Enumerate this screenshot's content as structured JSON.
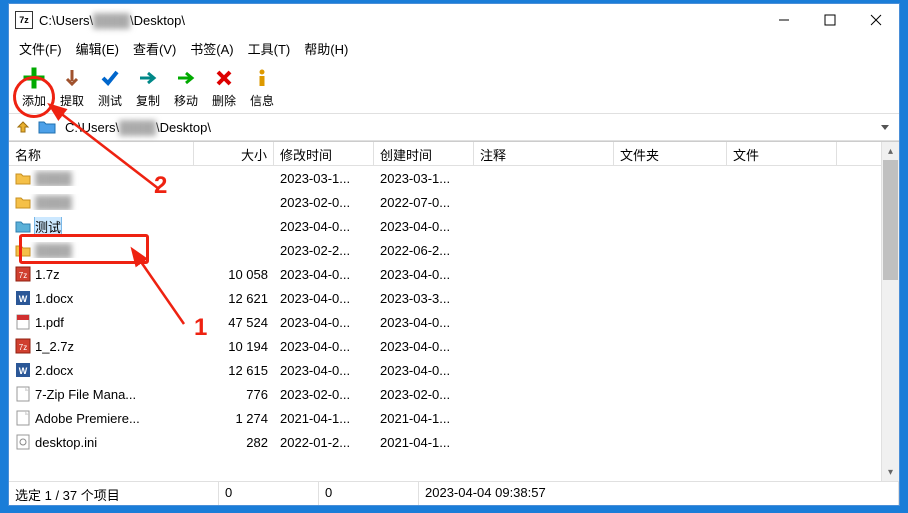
{
  "window": {
    "title_prefix": "C:\\Users\\",
    "title_suffix": "\\Desktop\\"
  },
  "menu": {
    "file": "文件(F)",
    "edit": "编辑(E)",
    "view": "查看(V)",
    "bookmark": "书签(A)",
    "tools": "工具(T)",
    "help": "帮助(H)"
  },
  "toolbar": {
    "add": "添加",
    "extract": "提取",
    "test": "测试",
    "copy": "复制",
    "move": "移动",
    "delete": "删除",
    "info": "信息"
  },
  "address": {
    "prefix": "C:\\Users\\",
    "suffix": "\\Desktop\\"
  },
  "columns": {
    "name": "名称",
    "size": "大小",
    "modified": "修改时间",
    "created": "创建时间",
    "comment": "注释",
    "folder": "文件夹",
    "file": "文件"
  },
  "col_widths": {
    "name": 185,
    "size": 80,
    "modified": 100,
    "created": 100,
    "comment": 140,
    "folder": 113,
    "file": 110
  },
  "rows": [
    {
      "icon": "folder-y",
      "name": "████",
      "blur": true,
      "size": "",
      "modified": "2023-03-1...",
      "created": "2023-03-1...",
      "selected": false
    },
    {
      "icon": "folder-y",
      "name": "████",
      "blur": true,
      "size": "",
      "modified": "2023-02-0...",
      "created": "2022-07-0...",
      "selected": false
    },
    {
      "icon": "folder-b",
      "name": "测试",
      "blur": false,
      "size": "",
      "modified": "2023-04-0...",
      "created": "2023-04-0...",
      "selected": true
    },
    {
      "icon": "folder-y",
      "name": "████",
      "blur": true,
      "size": "",
      "modified": "2023-02-2...",
      "created": "2022-06-2...",
      "selected": false
    },
    {
      "icon": "7z",
      "name": "1.7z",
      "blur": false,
      "size": "10 058",
      "modified": "2023-04-0...",
      "created": "2023-04-0...",
      "selected": false
    },
    {
      "icon": "docx",
      "name": "1.docx",
      "blur": false,
      "size": "12 621",
      "modified": "2023-04-0...",
      "created": "2023-03-3...",
      "selected": false
    },
    {
      "icon": "pdf",
      "name": "1.pdf",
      "blur": false,
      "size": "47 524",
      "modified": "2023-04-0...",
      "created": "2023-04-0...",
      "selected": false
    },
    {
      "icon": "7z",
      "name": "1_2.7z",
      "blur": false,
      "size": "10 194",
      "modified": "2023-04-0...",
      "created": "2023-04-0...",
      "selected": false
    },
    {
      "icon": "docx",
      "name": "2.docx",
      "blur": false,
      "size": "12 615",
      "modified": "2023-04-0...",
      "created": "2023-04-0...",
      "selected": false
    },
    {
      "icon": "generic",
      "name": "7-Zip File Mana...",
      "blur": false,
      "size": "776",
      "modified": "2023-02-0...",
      "created": "2023-02-0...",
      "selected": false
    },
    {
      "icon": "generic",
      "name": "Adobe Premiere...",
      "blur": false,
      "size": "1 274",
      "modified": "2021-04-1...",
      "created": "2021-04-1...",
      "selected": false
    },
    {
      "icon": "ini",
      "name": "desktop.ini",
      "blur": false,
      "size": "282",
      "modified": "2022-01-2...",
      "created": "2021-04-1...",
      "selected": false
    }
  ],
  "status": {
    "selection": "选定 1 / 37 个项目",
    "v1": "0",
    "v2": "0",
    "datetime": "2023-04-04 09:38:57"
  },
  "annotations": {
    "num1": "1",
    "num2": "2"
  }
}
